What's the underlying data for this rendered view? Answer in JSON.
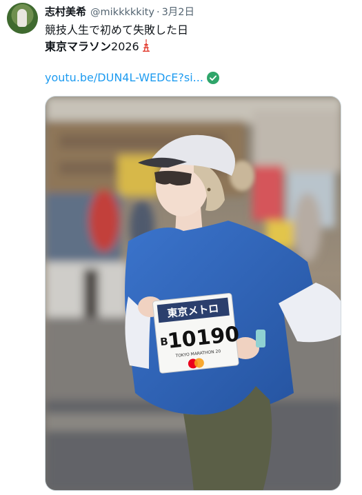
{
  "tweet": {
    "author_name": "志村美希",
    "handle": "@mikkkkkity",
    "separator": "·",
    "date": "3月2日",
    "text_line1": "競技人生で初めて失敗した日",
    "text_line2_bold": "東京マラソン",
    "text_line2_rest": "2026",
    "link_text": "youtu.be/DUN4L-WEDcE?si...",
    "link_color": "#1d9bf0"
  },
  "media": {
    "bib_sponsor": "東京メトロ",
    "bib_letter": "B",
    "bib_number": "10190",
    "bib_event": "TOKYO MARATHON 20"
  },
  "icons": [
    "tokyo-tower-icon",
    "verified-check-icon",
    "mastercard-logo"
  ],
  "colors": {
    "shirt": "#2c63b8",
    "cap": "#e4e6ec",
    "tights": "#5b5f47",
    "check": "#2fa56a"
  }
}
